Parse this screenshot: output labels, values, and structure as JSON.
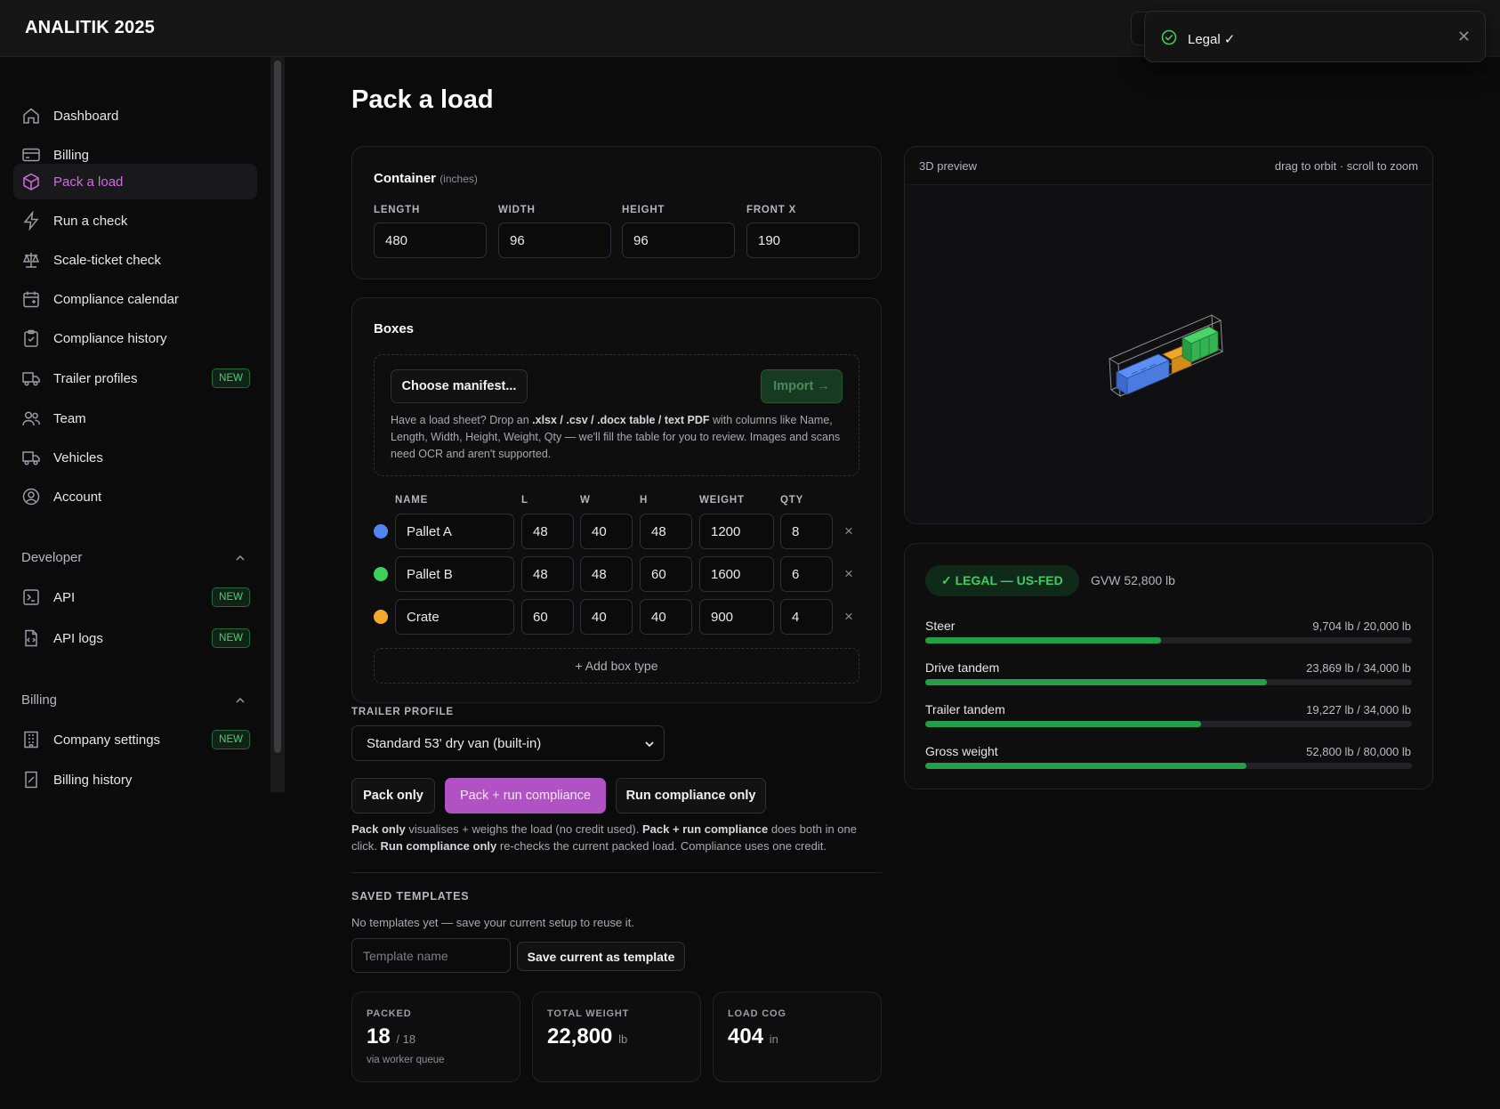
{
  "app": {
    "brand": "ANALITIK 2025"
  },
  "toast": {
    "message": "Legal ✓",
    "close": "✕"
  },
  "sidebar": {
    "items": [
      {
        "label": "Dashboard",
        "icon": "home-icon"
      },
      {
        "label": "Billing",
        "icon": "credit-card-icon"
      },
      {
        "label": "Pack a load",
        "icon": "package-icon",
        "active": true
      },
      {
        "label": "Run a check",
        "icon": "lightning-icon"
      },
      {
        "label": "Scale-ticket check",
        "icon": "scale-icon"
      },
      {
        "label": "Compliance calendar",
        "icon": "calendar-icon"
      },
      {
        "label": "Compliance history",
        "icon": "clipboard-icon"
      },
      {
        "label": "Trailer profiles",
        "icon": "truck-icon",
        "badge": "NEW"
      },
      {
        "label": "Team",
        "icon": "users-icon"
      },
      {
        "label": "Vehicles",
        "icon": "truck-icon"
      },
      {
        "label": "Account",
        "icon": "user-circle-icon"
      }
    ],
    "developer": {
      "title": "Developer",
      "items": [
        {
          "label": "API",
          "icon": "terminal-icon",
          "badge": "NEW"
        },
        {
          "label": "API logs",
          "icon": "file-code-icon",
          "badge": "NEW"
        }
      ]
    },
    "billing": {
      "title": "Billing",
      "items": [
        {
          "label": "Company settings",
          "icon": "building-icon",
          "badge": "NEW"
        },
        {
          "label": "Billing history",
          "icon": "receipt-icon"
        }
      ]
    }
  },
  "page": {
    "title": "Pack a load"
  },
  "container": {
    "title": "Container",
    "unit": "(inches)",
    "fields": [
      {
        "label": "LENGTH",
        "value": "480"
      },
      {
        "label": "WIDTH",
        "value": "96"
      },
      {
        "label": "HEIGHT",
        "value": "96"
      },
      {
        "label": "FRONT X",
        "value": "190"
      }
    ]
  },
  "boxes": {
    "title": "Boxes",
    "choose_label": "Choose manifest...",
    "import_label": "Import →",
    "help": {
      "p1": "Have a load sheet? Drop an ",
      "b1": ".xlsx / .csv / .docx table / text PDF",
      "p2": " with columns like Name, Length, Width, Height, Weight, Qty — we'll fill the table for you to review. Images and scans need OCR and aren't supported."
    },
    "headers": [
      "NAME",
      "L",
      "W",
      "H",
      "WEIGHT",
      "QTY"
    ],
    "rows": [
      {
        "color": "#4f86f2",
        "name": "Pallet A",
        "l": "48",
        "w": "40",
        "h": "48",
        "weight": "1200",
        "qty": "8"
      },
      {
        "color": "#3ccf5a",
        "name": "Pallet B",
        "l": "48",
        "w": "48",
        "h": "60",
        "weight": "1600",
        "qty": "6"
      },
      {
        "color": "#f2a92b",
        "name": "Crate",
        "l": "60",
        "w": "40",
        "h": "40",
        "weight": "900",
        "qty": "4"
      }
    ],
    "delete_glyph": "×",
    "add_label": "+ Add box type"
  },
  "trailer": {
    "label": "TRAILER PROFILE",
    "selected": "Standard 53' dry van (built-in)"
  },
  "actions": {
    "pack_only": "Pack only",
    "pack_run": "Pack + run compliance",
    "run_only": "Run compliance only",
    "help": {
      "b1": "Pack only",
      "p1": " visualises + weighs the load (no credit used). ",
      "b2": "Pack + run compliance",
      "p2": " does both in one click. ",
      "b3": "Run compliance only",
      "p3": " re-checks the current packed load. Compliance uses one credit."
    }
  },
  "templates": {
    "title": "SAVED TEMPLATES",
    "empty": "No templates yet — save your current setup to reuse it.",
    "input_placeholder": "Template name",
    "save_label": "Save current as template"
  },
  "stats": [
    {
      "label": "PACKED",
      "value": "18",
      "unit": "/ 18",
      "sub": "via worker queue"
    },
    {
      "label": "TOTAL WEIGHT",
      "value": "22,800",
      "unit": "lb"
    },
    {
      "label": "LOAD COG",
      "value": "404",
      "unit": "in"
    }
  ],
  "preview": {
    "title": "3D preview",
    "hint": "drag to orbit · scroll to zoom"
  },
  "compliance": {
    "status": "✓ LEGAL — US-FED",
    "gvw": "GVW 52,800 lb",
    "axles": [
      {
        "label": "Steer",
        "value": "9,704 lb / 20,000 lb",
        "fraction": 0.485
      },
      {
        "label": "Drive tandem",
        "value": "23,869 lb / 34,000 lb",
        "fraction": 0.702
      },
      {
        "label": "Trailer tandem",
        "value": "19,227 lb / 34,000 lb",
        "fraction": 0.566
      },
      {
        "label": "Gross weight",
        "value": "52,800 lb / 80,000 lb",
        "fraction": 0.66
      }
    ]
  },
  "colors": {
    "accent": "#c055d1",
    "ok": "#22a046",
    "pallet_a": "#4f86f2",
    "pallet_b": "#3ccf5a",
    "crate": "#f2a92b"
  }
}
